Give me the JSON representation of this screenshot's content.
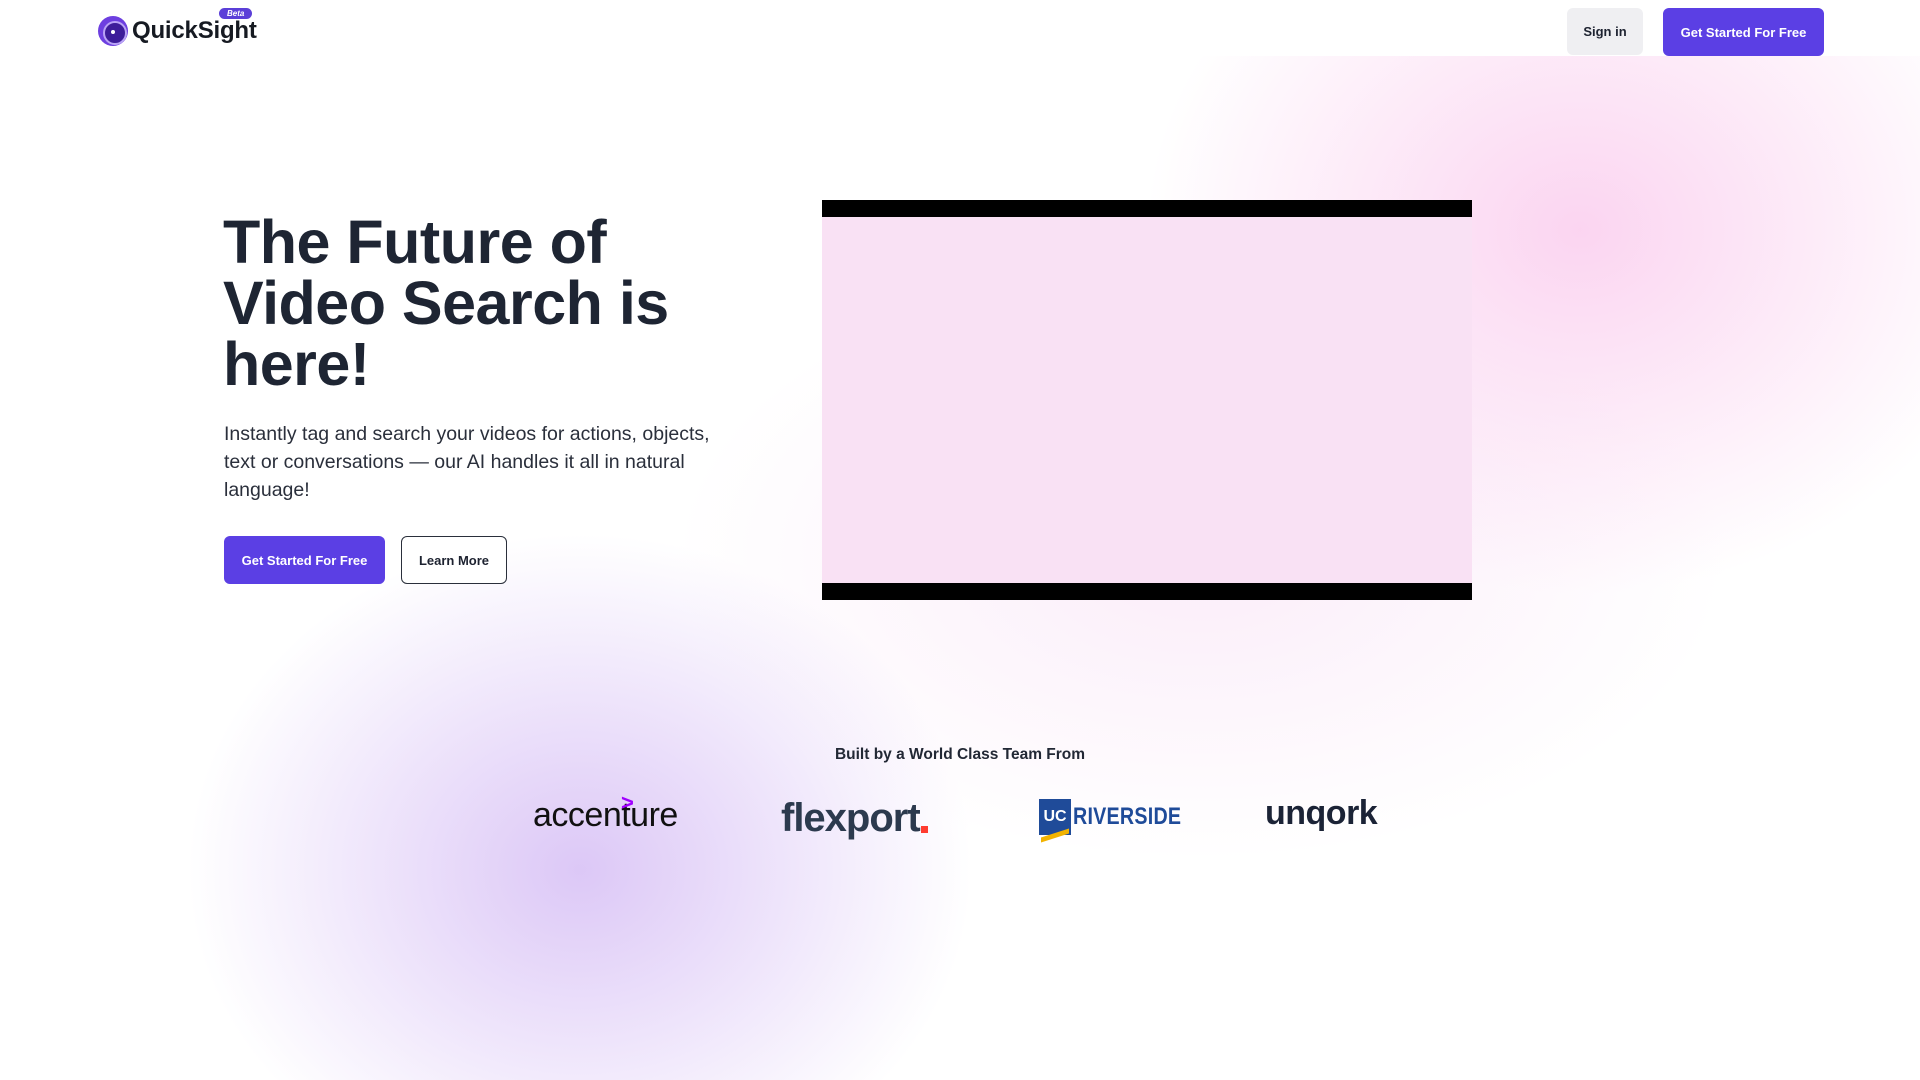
{
  "header": {
    "logo_text": "QuickSight",
    "beta_label": "Beta",
    "signin_label": "Sign in",
    "cta_label": "Get Started For Free"
  },
  "hero": {
    "title": "The Future of Video Search is here!",
    "subtitle": "Instantly tag and search your videos for actions, objects, text or conversations — our AI handles it all in natural language!",
    "cta_label": "Get Started For Free",
    "learn_more_label": "Learn More"
  },
  "team": {
    "heading": "Built by a World Class Team From",
    "logos": [
      "accenture",
      "flexport",
      "UC RIVERSIDE",
      "unqork"
    ],
    "ucr_mark": "UC",
    "ucr_text": "RIVERSIDE"
  },
  "colors": {
    "primary": "#5b3fe4",
    "text_dark": "#1e2533",
    "video_placeholder": "#f9e1f4"
  }
}
